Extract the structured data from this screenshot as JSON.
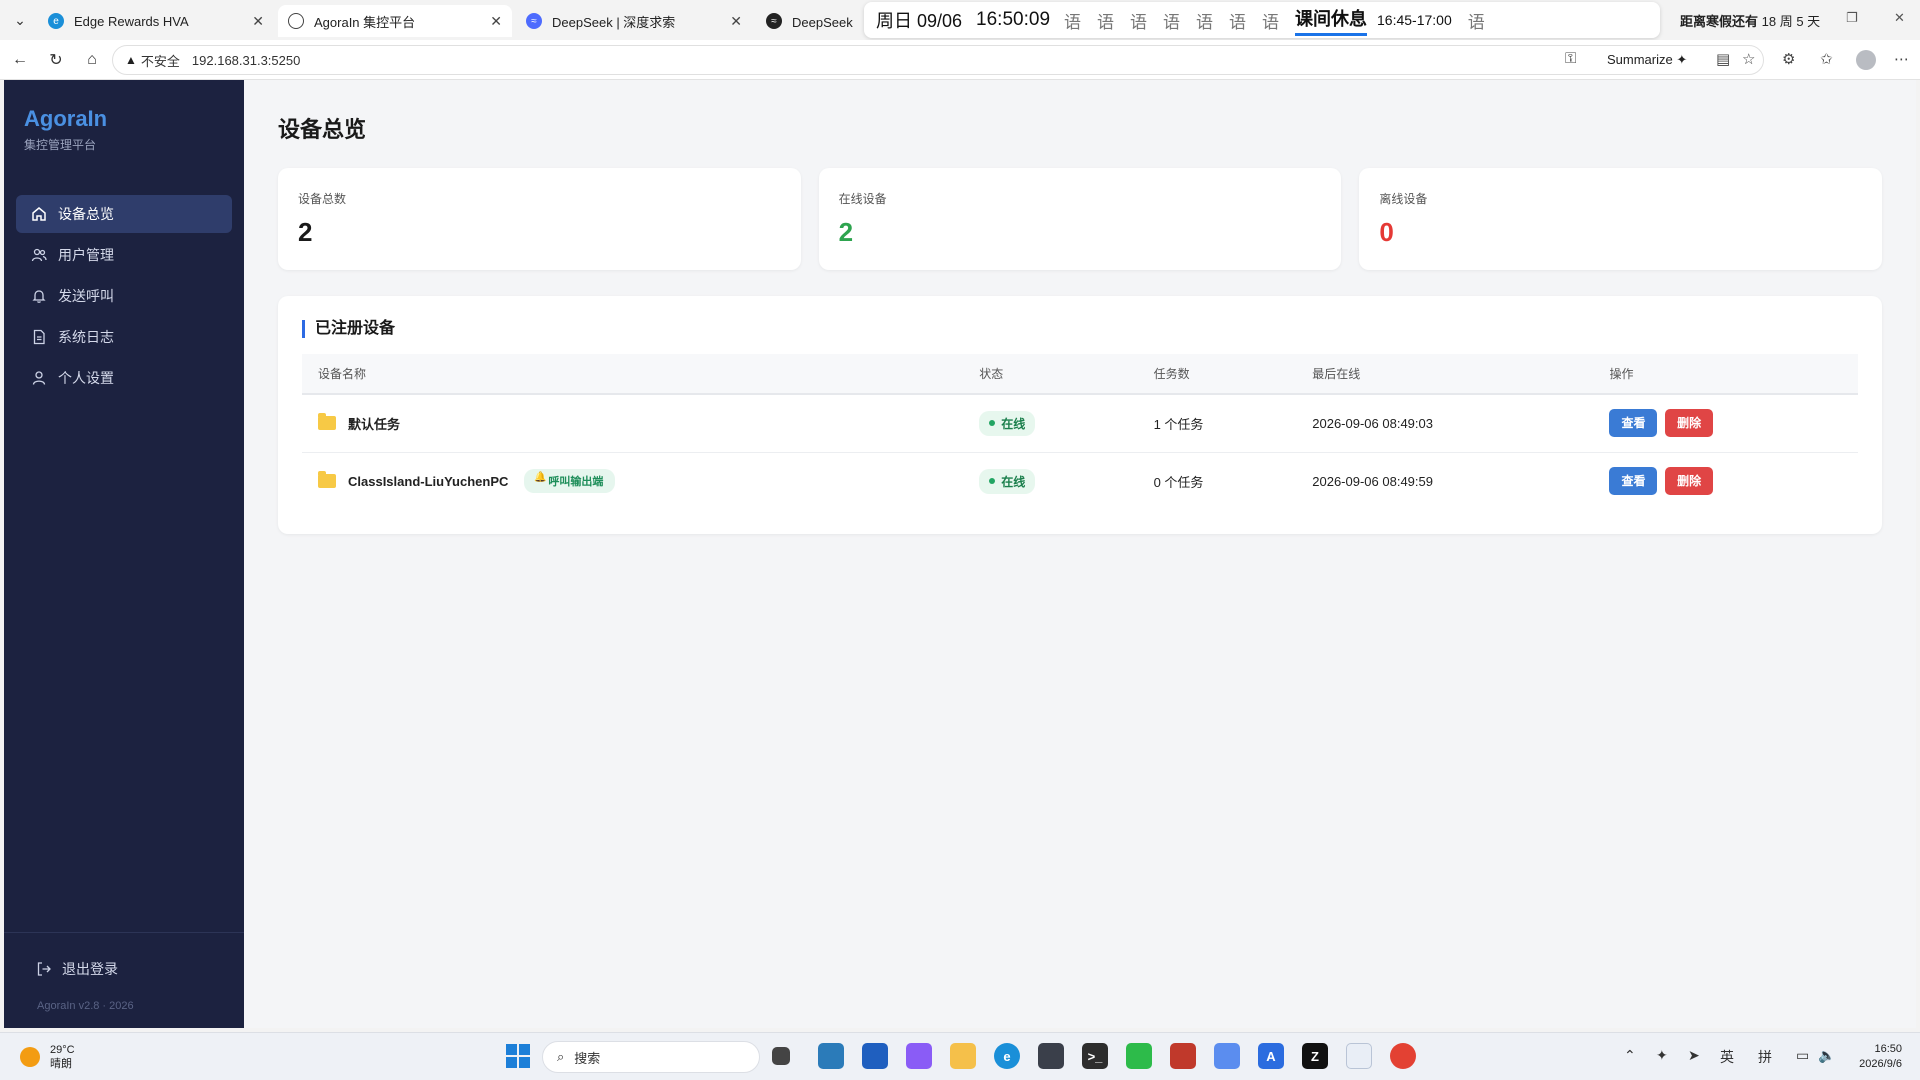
{
  "browser": {
    "tabs": [
      {
        "title": "Edge Rewards HVA",
        "active": false
      },
      {
        "title": "AgoraIn 集控平台",
        "active": true
      },
      {
        "title": "DeepSeek | 深度求索",
        "active": false
      },
      {
        "title": "DeepSeek 开放平",
        "active": false
      }
    ],
    "overlay": {
      "date": "周日 09/06",
      "time": "16:50:09",
      "lesson_chars": [
        "语",
        "语",
        "语",
        "语",
        "语",
        "语",
        "语",
        "语"
      ],
      "current": "课间休息",
      "range": "16:45-17:00",
      "countdown_prefix": "距离寒假还有",
      "countdown_value": "18 周 5 天"
    },
    "address": {
      "insecure_label": "不安全",
      "url": "192.168.31.3:5250",
      "summarize_label": "Summarize"
    }
  },
  "sidebar": {
    "brand": "AgoraIn",
    "subtitle": "集控管理平台",
    "items": [
      {
        "label": "设备总览",
        "icon": "home-icon"
      },
      {
        "label": "用户管理",
        "icon": "users-icon"
      },
      {
        "label": "发送呼叫",
        "icon": "bell-icon"
      },
      {
        "label": "系统日志",
        "icon": "document-icon"
      },
      {
        "label": "个人设置",
        "icon": "user-icon"
      }
    ],
    "logout_label": "退出登录",
    "version": "AgoraIn v2.8 · 2026"
  },
  "main": {
    "title": "设备总览",
    "stats": [
      {
        "label": "设备总数",
        "value": "2",
        "color": "#1a1a1a"
      },
      {
        "label": "在线设备",
        "value": "2",
        "color": "#2ea44f"
      },
      {
        "label": "离线设备",
        "value": "0",
        "color": "#e53935"
      }
    ],
    "panel_title": "已注册设备",
    "table": {
      "headers": [
        "设备名称",
        "状态",
        "任务数",
        "最后在线",
        "操作"
      ],
      "rows": [
        {
          "name": "默认任务",
          "tag": "",
          "status": "在线",
          "tasks": "1 个任务",
          "last_online": "2026-09-06 08:49:03",
          "view": "查看",
          "delete": "删除"
        },
        {
          "name": "ClassIsland-LiuYuchenPC",
          "tag": "呼叫输出端",
          "status": "在线",
          "tasks": "0 个任务",
          "last_online": "2026-09-06 08:49:59",
          "view": "查看",
          "delete": "删除"
        }
      ]
    }
  },
  "taskbar": {
    "temp": "29°C",
    "weather": "晴朗",
    "search_placeholder": "搜索",
    "tray_lang1": "英",
    "tray_lang2": "拼",
    "clock_time": "16:50",
    "clock_date": "2026/9/6"
  }
}
